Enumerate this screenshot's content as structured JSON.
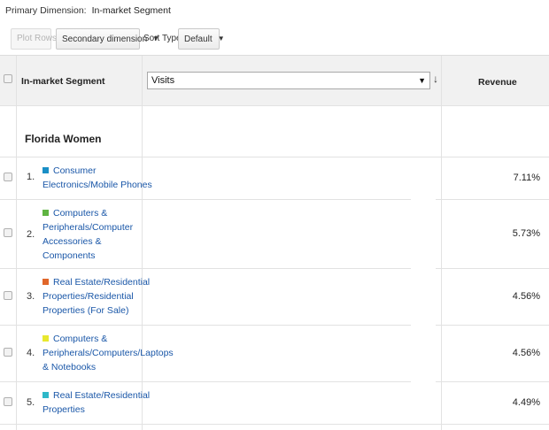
{
  "primary_dimension": {
    "label": "Primary Dimension:",
    "value": "In-market Segment"
  },
  "toolbar": {
    "plot_rows": "Plot Rows",
    "secondary_dimension": "Secondary dimension",
    "sort_type_label": "Sort Type:",
    "sort_type_value": "Default"
  },
  "table": {
    "col_segment": "In-market Segment",
    "col_metric": "Visits",
    "col_revenue": "Revenue",
    "group": "Florida Women",
    "rows": [
      {
        "num": "1.",
        "label": "Consumer Electronics/Mobile Phones",
        "color": "#1a8fc6",
        "revenue": "7.11%"
      },
      {
        "num": "2.",
        "label": "Computers & Peripherals/Computer Accessories & Components",
        "color": "#5fb442",
        "revenue": "5.73%"
      },
      {
        "num": "3.",
        "label": "Real Estate/Residential Properties/Residential Properties (For Sale)",
        "color": "#e0662a",
        "revenue": "4.56%"
      },
      {
        "num": "4.",
        "label": "Computers & Peripherals/Computers/Laptops & Notebooks",
        "color": "#e8e82e",
        "revenue": "4.56%"
      },
      {
        "num": "5.",
        "label": "Real Estate/Residential Properties",
        "color": "#2eb8c8",
        "revenue": "4.49%"
      }
    ]
  }
}
